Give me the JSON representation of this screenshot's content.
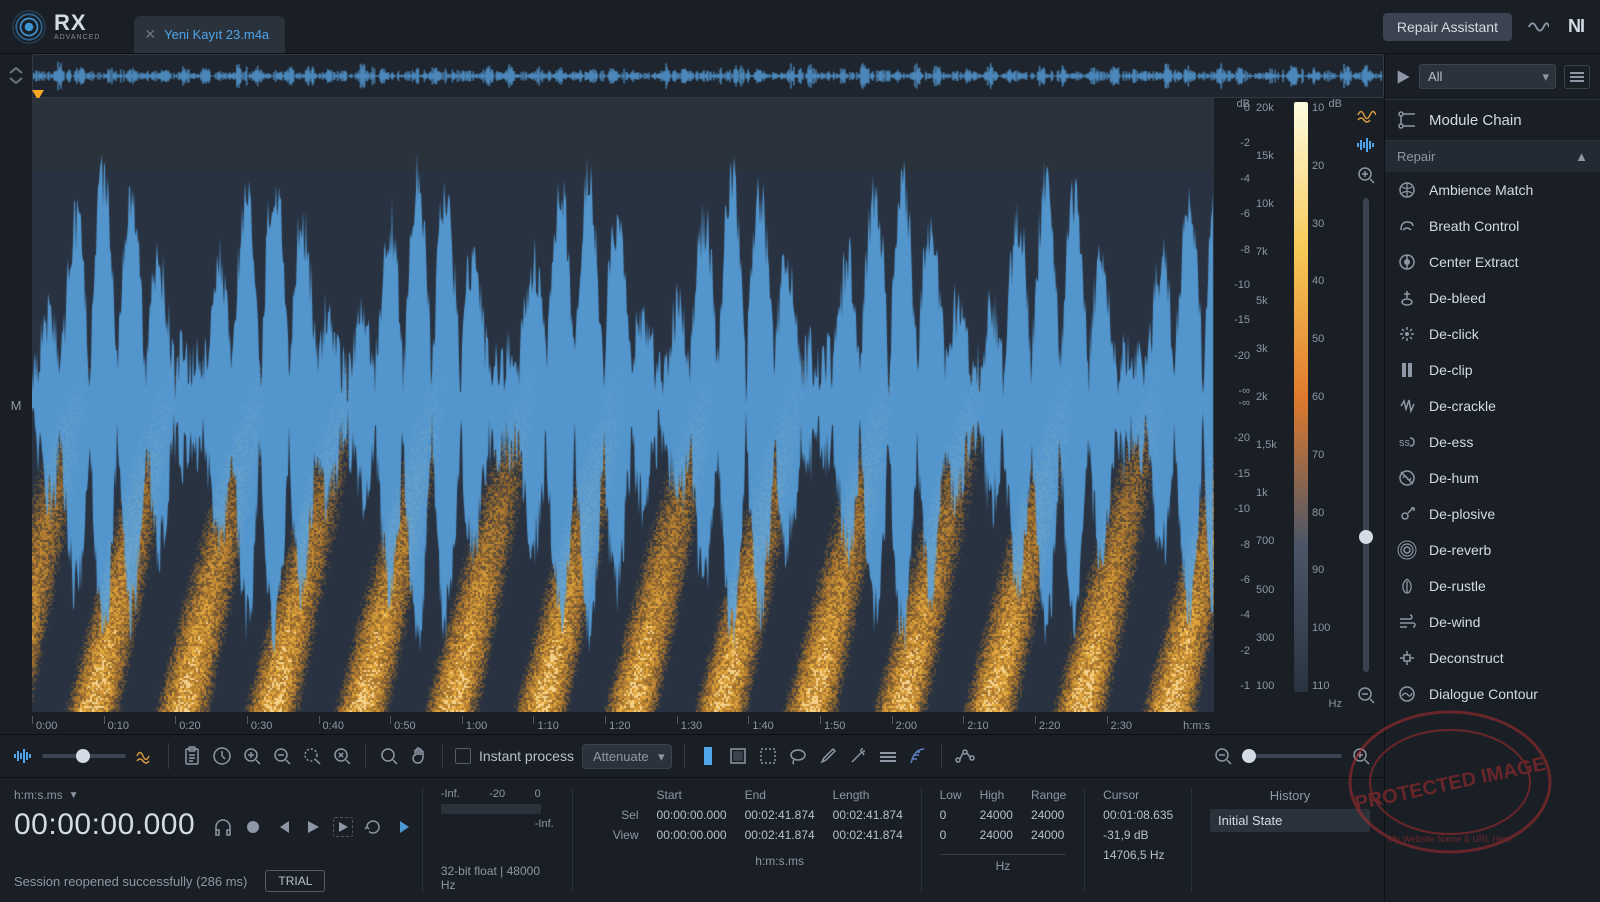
{
  "app": {
    "logo_main": "RX",
    "logo_sub": "ADVANCED"
  },
  "tabs": [
    {
      "title": "Yeni Kayıt 23.m4a"
    }
  ],
  "top": {
    "repair_assistant": "Repair Assistant",
    "ni": "NI"
  },
  "overview": {
    "channel_label": "M"
  },
  "scales": {
    "db_unit": "dB",
    "db_top": [
      "0",
      "-2",
      "-4",
      "-6",
      "-8",
      "-10",
      "-15",
      "-20",
      "-∞"
    ],
    "db_bot": [
      "-∞",
      "-20",
      "-15",
      "-10",
      "-8",
      "-6",
      "-4",
      "-2",
      "-1"
    ],
    "hz_unit": "Hz",
    "hz": [
      "20k",
      "15k",
      "10k",
      "7k",
      "5k",
      "3k",
      "2k",
      "1,5k",
      "1k",
      "700",
      "500",
      "300",
      "100"
    ],
    "color_db_unit": "dB",
    "color_db": [
      "10",
      "20",
      "30",
      "40",
      "50",
      "60",
      "70",
      "80",
      "90",
      "100",
      "110"
    ]
  },
  "time_axis": {
    "ticks": [
      "0:00",
      "0:10",
      "0:20",
      "0:30",
      "0:40",
      "0:50",
      "1:00",
      "1:10",
      "1:20",
      "1:30",
      "1:40",
      "1:50",
      "2:00",
      "2:10",
      "2:20",
      "2:30"
    ],
    "unit": "h:m:s"
  },
  "toolbar": {
    "instant_process": "Instant process",
    "attenuate": "Attenuate"
  },
  "bottom": {
    "time_format": "h:m:s.ms",
    "big_time": "00:00:00.000",
    "status": "Session reopened successfully (286 ms)",
    "trial": "TRIAL",
    "meter": {
      "l1": "-Inf.",
      "l2": "-20",
      "l3": "0",
      "r": "-Inf."
    },
    "audio_format": "32-bit float | 48000 Hz",
    "grid": {
      "hdr_start": "Start",
      "hdr_end": "End",
      "hdr_length": "Length",
      "sel_label": "Sel",
      "view_label": "View",
      "sel_start": "00:00:00.000",
      "sel_end": "00:02:41.874",
      "sel_len": "00:02:41.874",
      "view_start": "00:00:00.000",
      "view_end": "00:02:41.874",
      "view_len": "00:02:41.874",
      "time_unit": "h:m:s.ms"
    },
    "freq": {
      "hdr_low": "Low",
      "hdr_high": "High",
      "hdr_range": "Range",
      "sel_low": "0",
      "sel_high": "24000",
      "sel_range": "24000",
      "view_low": "0",
      "view_high": "24000",
      "view_range": "24000",
      "unit": "Hz"
    },
    "cursor": {
      "hdr": "Cursor",
      "time": "00:01:08.635",
      "db": "-31,9 dB",
      "hz": "14706,5 Hz"
    },
    "history": {
      "hdr": "History",
      "items": [
        "Initial State"
      ]
    }
  },
  "right": {
    "filter": "All",
    "module_chain": "Module Chain",
    "section": "Repair",
    "modules": [
      "Ambience Match",
      "Breath Control",
      "Center Extract",
      "De-bleed",
      "De-click",
      "De-clip",
      "De-crackle",
      "De-ess",
      "De-hum",
      "De-plosive",
      "De-reverb",
      "De-rustle",
      "De-wind",
      "Deconstruct",
      "Dialogue Contour"
    ]
  },
  "watermark": {
    "text_top": "PROTECTED IMAGE",
    "text_bot": "My Website Name & URL Here"
  }
}
